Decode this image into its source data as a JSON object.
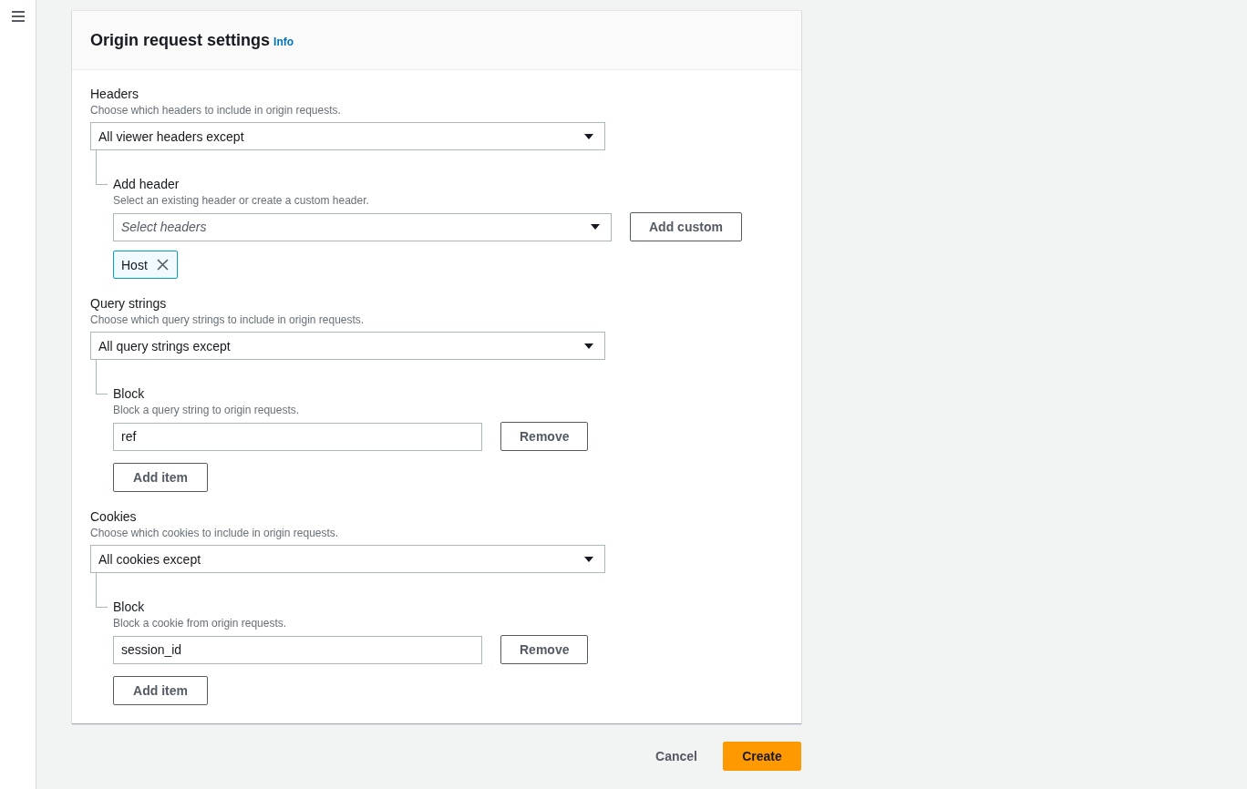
{
  "panel": {
    "title": "Origin request settings",
    "info_link": "Info"
  },
  "sections": [
    {
      "label": "Headers",
      "description": "Choose which headers to include in origin requests.",
      "select_value": "All viewer headers except",
      "sub": {
        "kind": "multiselect",
        "label": "Add header",
        "description": "Select an existing header or create a custom header.",
        "placeholder": "Select headers",
        "button": "Add custom",
        "tokens": [
          {
            "label": "Host"
          }
        ]
      }
    },
    {
      "label": "Query strings",
      "description": "Choose which query strings to include in origin requests.",
      "select_value": "All query strings except",
      "sub": {
        "kind": "list",
        "label": "Block",
        "description": "Block a query string to origin requests.",
        "items": [
          {
            "value": "ref",
            "button": "Remove"
          }
        ],
        "add_button": "Add item"
      }
    },
    {
      "label": "Cookies",
      "description": "Choose which cookies to include in origin requests.",
      "select_value": "All cookies except",
      "sub": {
        "kind": "list",
        "label": "Block",
        "description": "Block a cookie from origin requests.",
        "items": [
          {
            "value": "session_id",
            "button": "Remove"
          }
        ],
        "add_button": "Add item"
      }
    }
  ],
  "footer": {
    "cancel": "Cancel",
    "create": "Create"
  }
}
